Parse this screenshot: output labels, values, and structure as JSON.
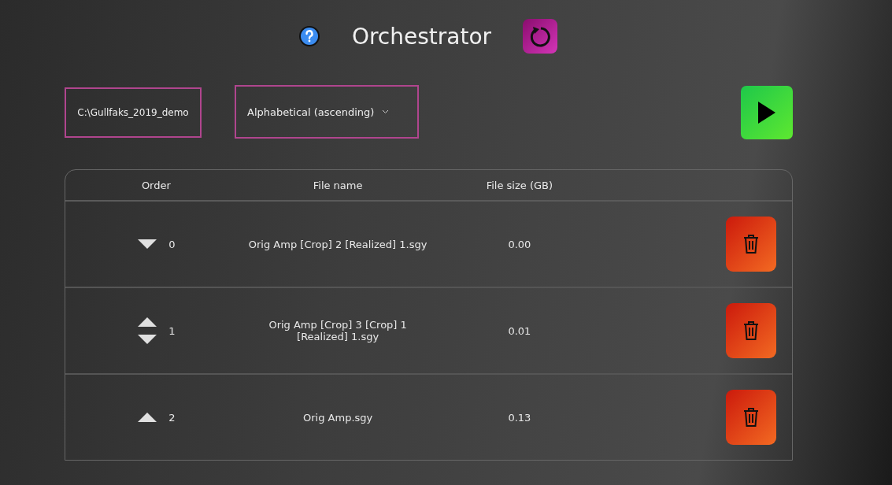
{
  "header": {
    "title": "Orchestrator"
  },
  "controls": {
    "folder": "C:\\Gullfaks_2019_demo",
    "sort": "Alphabetical (ascending)"
  },
  "table": {
    "columns": [
      "Order",
      "File name",
      "File size (GB)"
    ],
    "rows": [
      {
        "can_move_up": false,
        "can_move_down": true,
        "order": "0",
        "file_name": "Orig Amp [Crop] 2 [Realized] 1.sgy",
        "size": "0.00"
      },
      {
        "can_move_up": true,
        "can_move_down": true,
        "order": "1",
        "file_name": "Orig Amp [Crop] 3 [Crop] 1 [Realized] 1.sgy",
        "size": "0.01"
      },
      {
        "can_move_up": true,
        "can_move_down": false,
        "order": "2",
        "file_name": "Orig Amp.sgy",
        "size": "0.13"
      }
    ]
  }
}
